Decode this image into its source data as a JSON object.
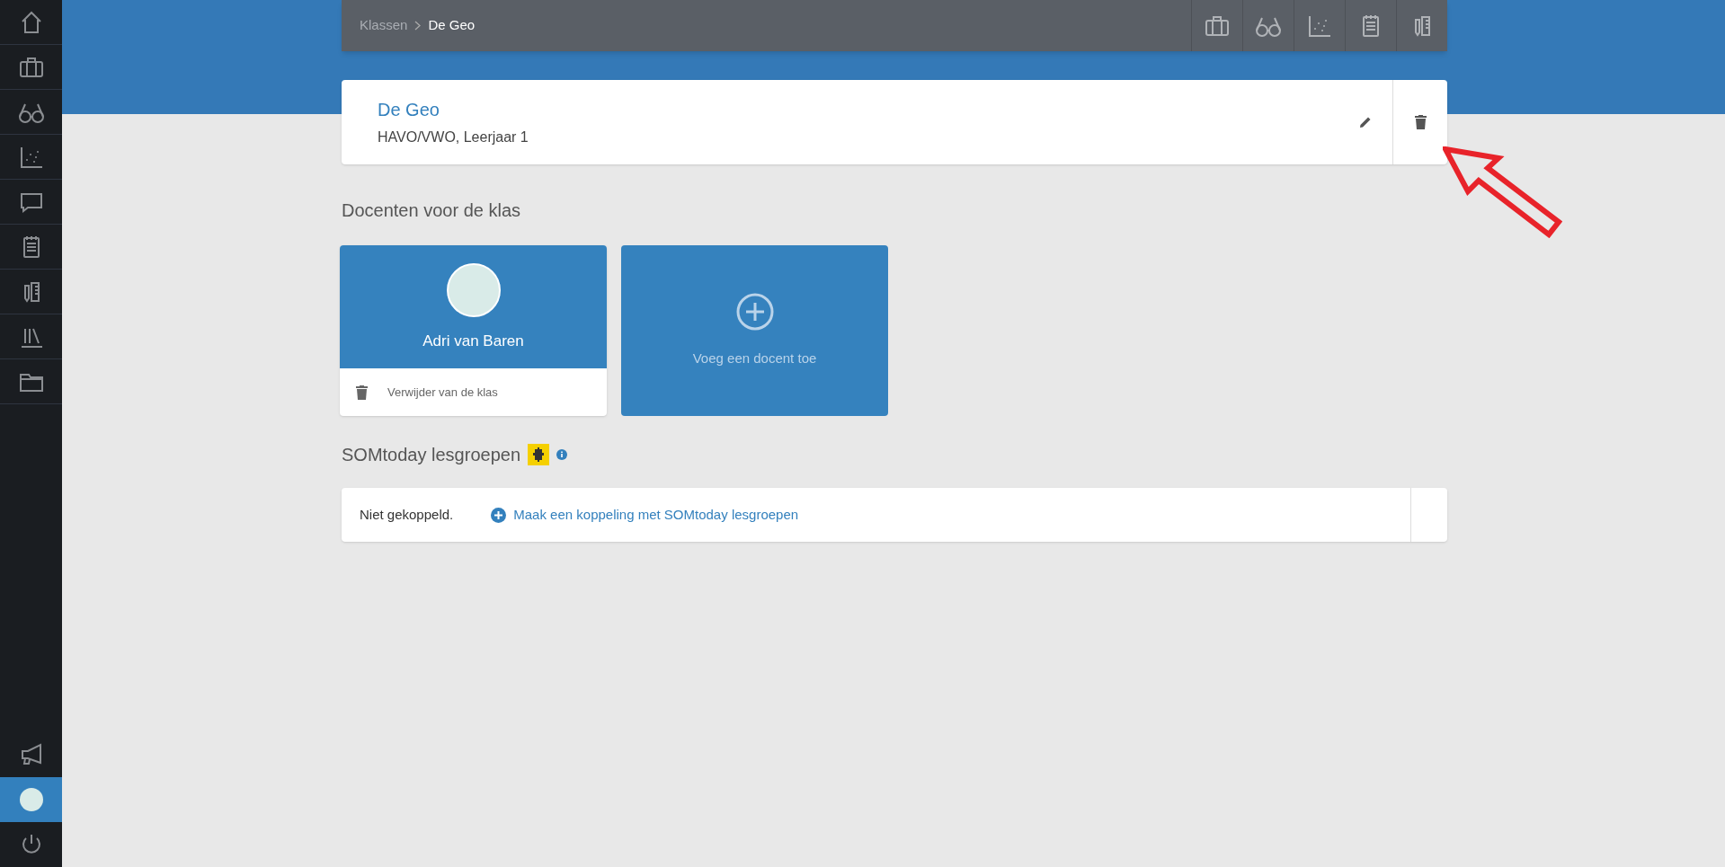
{
  "sidebar": {
    "items": [
      {
        "selected": false
      },
      {
        "selected": false
      },
      {
        "selected": false
      },
      {
        "selected": false
      },
      {
        "selected": false
      },
      {
        "selected": false
      },
      {
        "selected": false
      },
      {
        "selected": false
      },
      {
        "selected": false
      }
    ],
    "bottom_items": [
      {
        "selected": false
      },
      {
        "selected": true
      },
      {
        "selected": false
      }
    ]
  },
  "breadcrumb": [
    "Klassen",
    "De Geo"
  ],
  "class_card": {
    "title": "De Geo",
    "subtitle": "HAVO/VWO, Leerjaar 1"
  },
  "teachers_heading": "Docenten voor de klas",
  "teachers": [
    {
      "name": "Adri van Baren",
      "remove_label": "Verwijder van de klas"
    }
  ],
  "add_teacher": "Voeg een docent toe",
  "somtoday": {
    "heading": "SOMtoday lesgroepen",
    "status": "Niet gekoppeld.",
    "link": "Maak een koppeling met SOMtoday lesgroepen"
  }
}
